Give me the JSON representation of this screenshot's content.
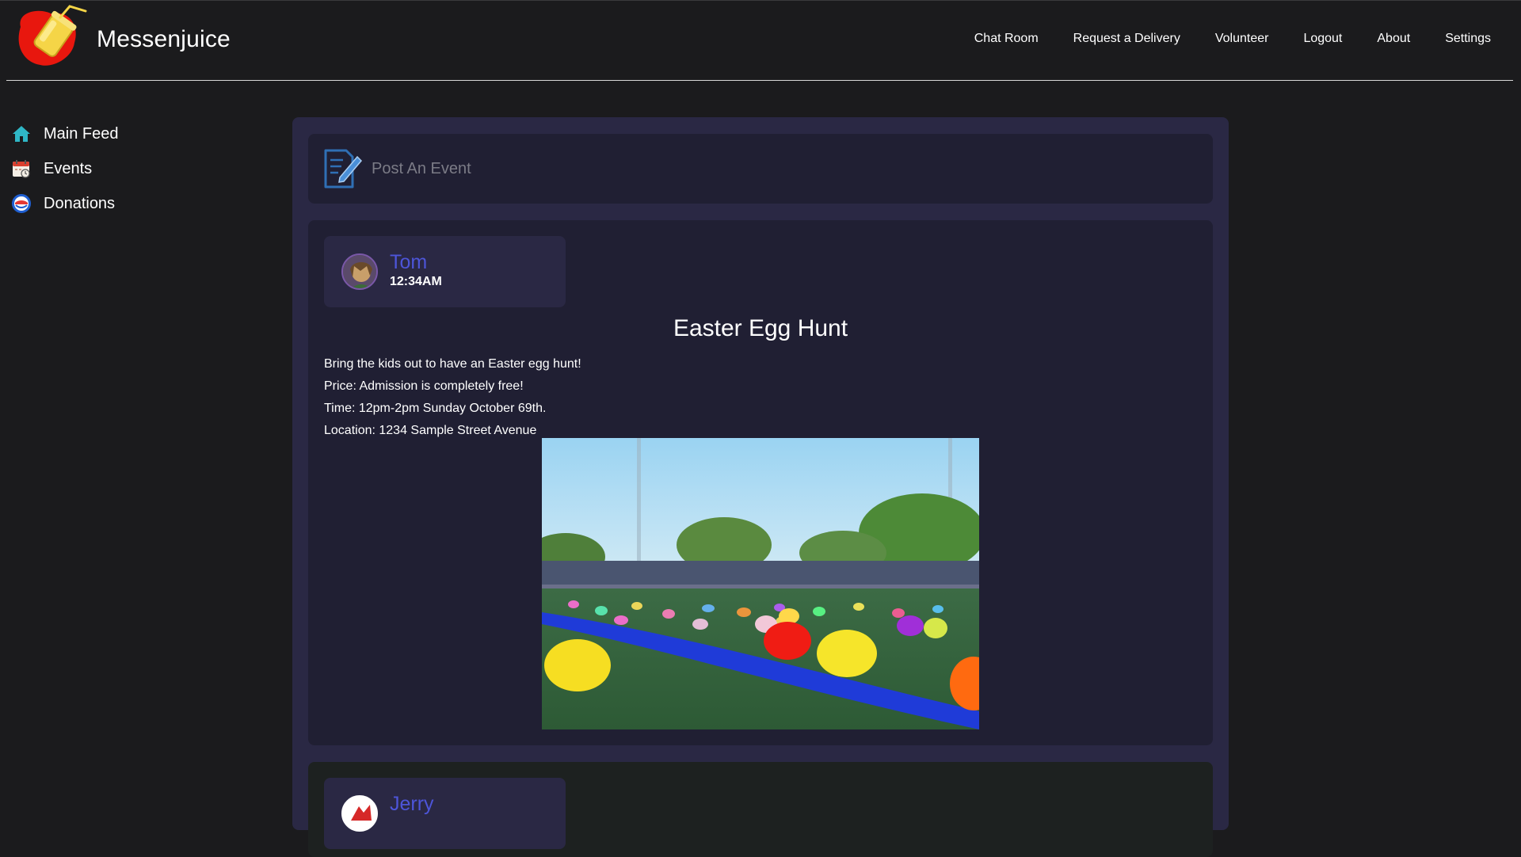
{
  "app": {
    "name": "Messenjuice"
  },
  "nav": {
    "items": [
      {
        "label": "Chat Room"
      },
      {
        "label": "Request a Delivery"
      },
      {
        "label": "Volunteer"
      },
      {
        "label": "Logout"
      },
      {
        "label": "About"
      },
      {
        "label": "Settings"
      }
    ]
  },
  "sidebar": {
    "items": [
      {
        "label": "Main Feed",
        "icon": "home-icon"
      },
      {
        "label": "Events",
        "icon": "calendar-icon"
      },
      {
        "label": "Donations",
        "icon": "donation-icon"
      }
    ]
  },
  "composer": {
    "placeholder": "Post An Event",
    "icon": "edit-document-icon"
  },
  "posts": [
    {
      "author": "Tom",
      "time": "12:34AM",
      "title": "Easter Egg Hunt",
      "lines": [
        "Bring the kids out to have an Easter egg hunt!",
        "Price: Admission is completely free!",
        "Time: 12pm-2pm Sunday October 69th.",
        "Location: 1234 Sample Street Avenue"
      ]
    },
    {
      "author": "Jerry"
    }
  ],
  "colors": {
    "background": "#1b1b1d",
    "feed_panel": "#2a2844",
    "card": "#201f33",
    "author_link": "#4d55d9",
    "muted_text": "#7b7b86"
  }
}
